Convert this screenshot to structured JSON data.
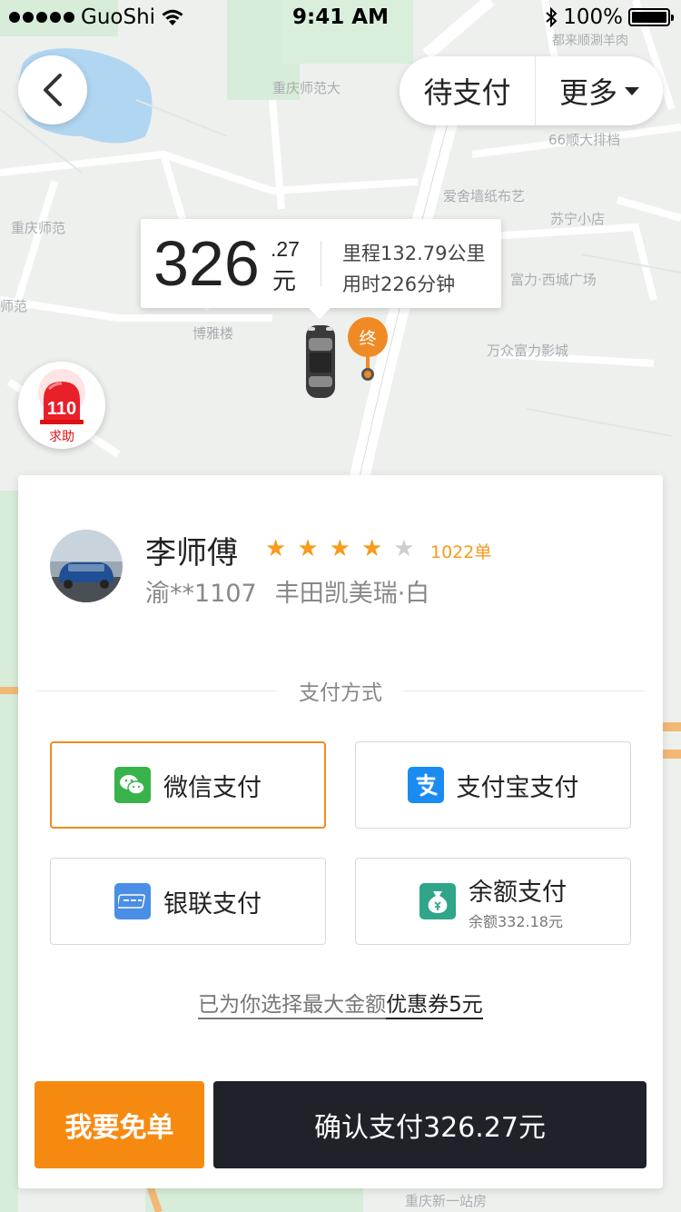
{
  "status_bar": {
    "carrier": "GuoShi",
    "time": "9:41 AM",
    "battery": "100%"
  },
  "map": {
    "labels": [
      "都来顺涮羊肉",
      "重庆师范大",
      "66顺大排档",
      "爱舍墙纸布艺",
      "苏宁小店",
      "重庆师范",
      "富力·西城广场",
      "师范",
      "博雅楼",
      "万众富力影城",
      "重庆新一站房"
    ]
  },
  "header": {
    "status": "待支付",
    "more": "更多"
  },
  "fare": {
    "integer": "326",
    "decimal": ".27",
    "unit": "元",
    "distance": "里程132.79公里",
    "duration": "用时226分钟"
  },
  "end_marker": {
    "label": "终"
  },
  "sos": {
    "number": "110",
    "label": "求助"
  },
  "driver": {
    "name": "李师傅",
    "rating": 4,
    "max_rating": 5,
    "orders": "1022单",
    "plate": "渝**1107",
    "car": "丰田凯美瑞·白"
  },
  "payment": {
    "title": "支付方式",
    "options": [
      {
        "label": "微信支付",
        "icon": "wechat-pay-icon",
        "color": "#37b34a",
        "selected": true
      },
      {
        "label": "支付宝支付",
        "icon": "alipay-icon",
        "color": "#1a8cf1",
        "selected": false
      },
      {
        "label": "银联支付",
        "icon": "unionpay-icon",
        "color": "#4a8ee6",
        "selected": false
      },
      {
        "label": "余额支付",
        "sub": "余额332.18元",
        "icon": "balance-icon",
        "color": "#2fa58a",
        "selected": false
      }
    ],
    "coupon_prefix": "已为你选择最大金额",
    "coupon_amount": "优惠券5元"
  },
  "actions": {
    "free": "我要免单",
    "confirm": "确认支付326.27元"
  },
  "colors": {
    "accent": "#f68a10",
    "dark": "#1f2229",
    "map_bg": "#eef0ee"
  }
}
